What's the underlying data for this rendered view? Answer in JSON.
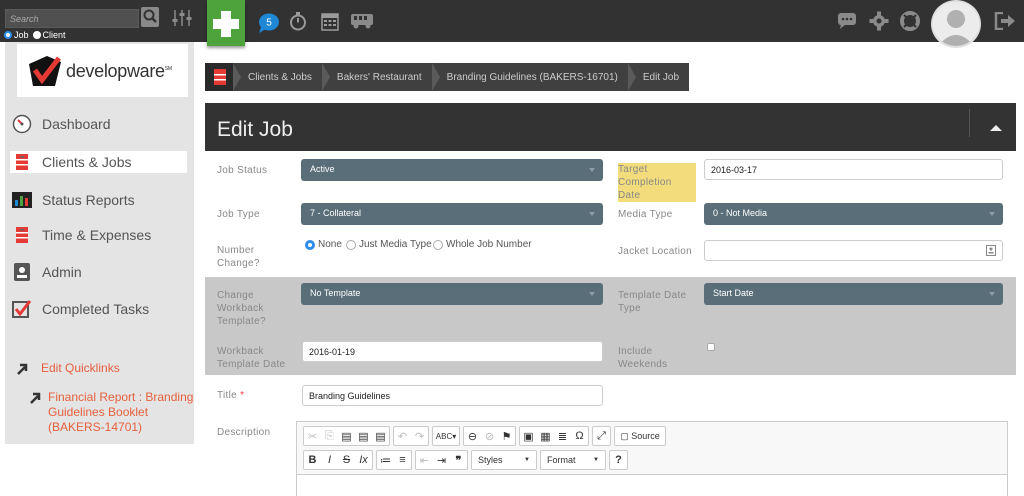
{
  "topbar": {
    "search_placeholder": "Search",
    "radio_job": "Job",
    "radio_client": "Client",
    "notification_count": "5"
  },
  "logo": {
    "text": "developware",
    "tm": "SM"
  },
  "sidebar": {
    "items": [
      {
        "label": "Dashboard",
        "icon": "dashboard-gauge-icon"
      },
      {
        "label": "Clients & Jobs",
        "icon": "cabinet-icon"
      },
      {
        "label": "Status Reports",
        "icon": "bar-chart-icon"
      },
      {
        "label": "Time & Expenses",
        "icon": "cabinet-icon"
      },
      {
        "label": "Admin",
        "icon": "id-card-icon"
      },
      {
        "label": "Completed Tasks",
        "icon": "checkbox-icon"
      }
    ],
    "quicklinks_label": "Edit Quicklinks",
    "quicklink_items": [
      "Financial Report : Branding",
      "Guidelines Booklet",
      "(BAKERS-14701)"
    ]
  },
  "breadcrumb": [
    "Clients & Jobs",
    "Bakers' Restaurant",
    "Branding Guidelines (BAKERS-16701)",
    "Edit Job"
  ],
  "panel": {
    "title": "Edit Job"
  },
  "form": {
    "job_status_label": "Job Status",
    "job_status_value": "Active",
    "target_date_label_1": "Target",
    "target_date_label_2": "Completion Date",
    "target_date_value": "2016-03-17",
    "job_type_label": "Job Type",
    "job_type_value": "7 - Collateral",
    "media_type_label": "Media Type",
    "media_type_value": "0 - Not Media",
    "number_change_label_1": "Number",
    "number_change_label_2": "Change?",
    "number_change_options": [
      "None",
      "Just Media Type",
      "Whole Job Number"
    ],
    "jacket_location_label": "Jacket Location",
    "change_template_label": [
      "Change",
      "Workback",
      "Template?"
    ],
    "change_template_value": "No Template",
    "template_date_type_label": [
      "Template Date",
      "Type"
    ],
    "template_date_type_value": "Start Date",
    "workback_date_label": [
      "Workback",
      "Template Date"
    ],
    "workback_date_value": "2016-01-19",
    "include_weekends_label": [
      "Include",
      "Weekends"
    ],
    "title_label": "Title",
    "title_required": "*",
    "title_value": "Branding Guidelines",
    "description_label": "Description"
  },
  "editor": {
    "source_label": "Source",
    "styles_label": "Styles",
    "format_label": "Format"
  },
  "colors": {
    "topbar": "#323232",
    "accent_green": "#4ea33c",
    "select_bg": "#596e78",
    "link": "#e5603d"
  }
}
